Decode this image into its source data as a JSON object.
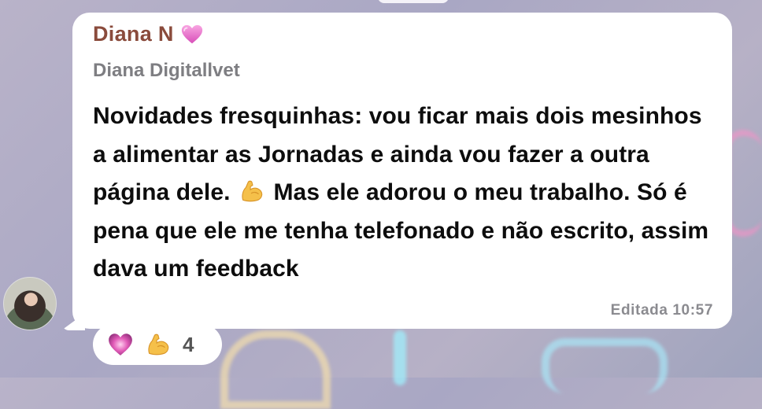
{
  "message": {
    "sender_name": "Diana N",
    "sender_badge_icon": "pink-heart-icon",
    "subtitle": "Diana Digitallvet",
    "text_part1": "Novidades fresquinhas: vou ficar mais dois mesinhos a alimentar as Jornadas e ainda vou fazer a outra página dele.",
    "inline_emoji": "flexed-biceps-icon",
    "text_part2": "Mas ele adorou o meu trabalho. Só é pena que ele me tenha telefonado e não escrito, assim dava um feedback",
    "status": "Editada",
    "time": "10:57"
  },
  "reactions": {
    "icons": [
      "heart-icon",
      "flexed-biceps-icon"
    ],
    "count": "4"
  },
  "colors": {
    "sender": "#8a4b3c",
    "subtitle": "#7e7e82",
    "bubble": "#ffffff"
  }
}
